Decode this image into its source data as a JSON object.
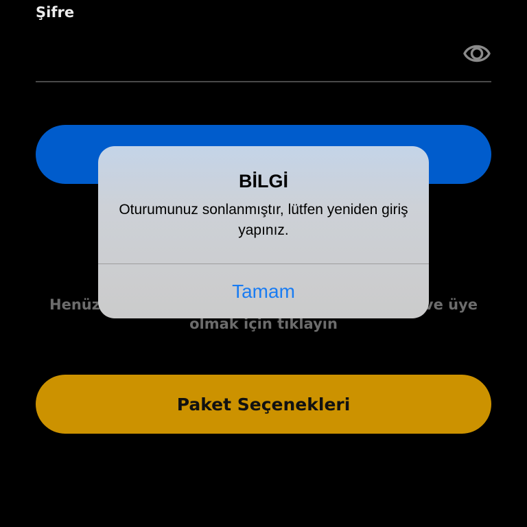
{
  "password": {
    "label": "Şifre",
    "value": "",
    "icon": "eye-icon"
  },
  "signup": {
    "prefix": "Henüz",
    "suffix": "ve üye",
    "line2": "olmak için tıklayın"
  },
  "package_button": {
    "label": "Paket Seçenekleri"
  },
  "alert": {
    "title": "BİLGİ",
    "message": "Oturumunuz sonlanmıştır, lütfen yeniden giriş yapınız.",
    "ok_label": "Tamam"
  },
  "colors": {
    "background": "#000000",
    "login_button": "#005ccc",
    "package_button": "#cc9200",
    "alert_action": "#1a7cf2"
  }
}
